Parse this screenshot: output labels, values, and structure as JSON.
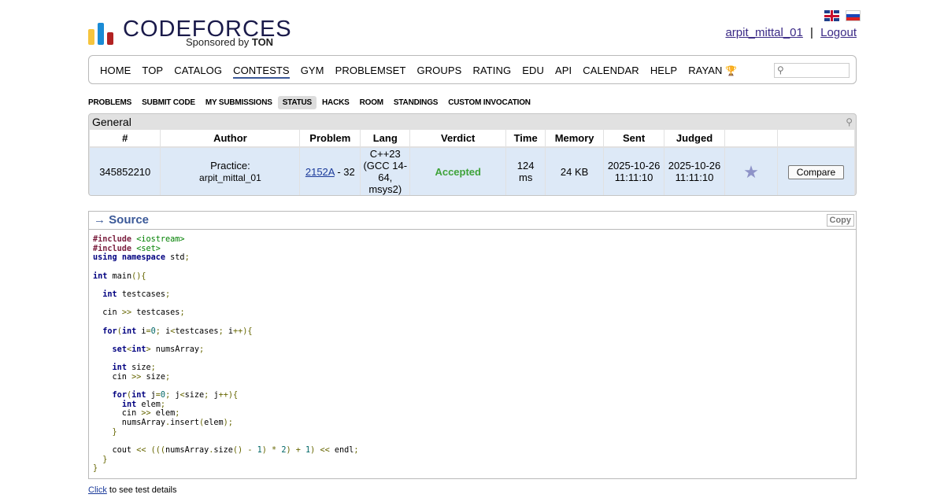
{
  "header": {
    "logo_text": "CODEFORCES",
    "sponsor_prefix": "Sponsored by",
    "sponsor_name": "TON",
    "username": "arpit_mittal_01",
    "separator": "|",
    "logout": "Logout"
  },
  "menu": {
    "items": [
      "HOME",
      "TOP",
      "CATALOG",
      "CONTESTS",
      "GYM",
      "PROBLEMSET",
      "GROUPS",
      "RATING",
      "EDU",
      "API",
      "CALENDAR",
      "HELP",
      "RAYAN"
    ],
    "active": "CONTESTS",
    "search_value": ""
  },
  "subtabs": {
    "items": [
      "PROBLEMS",
      "SUBMIT CODE",
      "MY SUBMISSIONS",
      "STATUS",
      "HACKS",
      "ROOM",
      "STANDINGS",
      "CUSTOM INVOCATION"
    ],
    "active": "STATUS"
  },
  "status": {
    "title": "General",
    "columns": [
      "#",
      "Author",
      "Problem",
      "Lang",
      "Verdict",
      "Time",
      "Memory",
      "Sent",
      "Judged",
      "",
      ""
    ],
    "row": {
      "id": "345852210",
      "author_prefix": "Practice:",
      "author": "arpit_mittal_01",
      "problem_link": "2152A",
      "problem_suffix": " - 32",
      "lang": "C++23 (GCC 14-64, msys2)",
      "verdict": "Accepted",
      "time_value": "124",
      "time_unit": "ms",
      "memory": "24 KB",
      "sent_date": "2025-10-26",
      "sent_time": "11:11:10",
      "judged_date": "2025-10-26",
      "judged_time": "11:11:10",
      "compare": "Compare"
    }
  },
  "source": {
    "title": "→ Source",
    "copy": "Copy",
    "code": "#include <iostream>\n#include <set>\nusing namespace std;\n\nint main(){\n\n  int testcases;\n\n  cin >> testcases;\n\n  for(int i=0; i<testcases; i++){\n\n    set<int> numsArray;\n\n    int size;\n    cin >> size;\n\n    for(int j=0; j<size; j++){\n      int elem;\n      cin >> elem;\n      numsArray.insert(elem);\n    }\n\n    cout << (((numsArray.size() - 1) * 2) + 1) << endl;\n  }\n}"
  },
  "footer": {
    "link": "Click",
    "text": " to see test details"
  },
  "colors": {
    "accent": "#3b5998",
    "accepted": "#3fa33a",
    "row_bg": "#dde9f7",
    "logo_bar_yellow": "#f6c43d",
    "logo_bar_blue": "#1a8bd5",
    "logo_bar_red": "#b22222"
  }
}
